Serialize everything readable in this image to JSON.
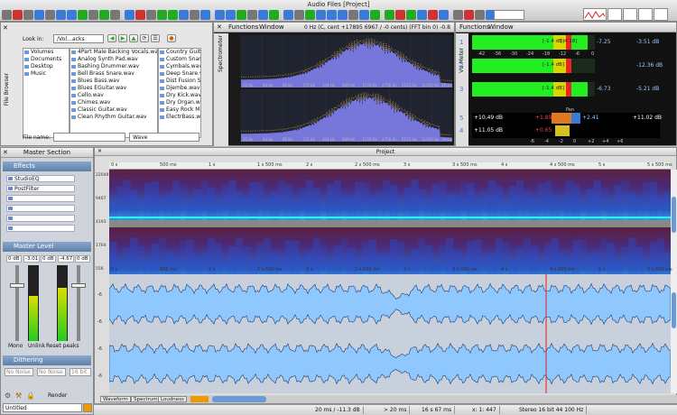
{
  "app": {
    "title": "Audio Files [Project]"
  },
  "colors": {
    "meter_green": "#22ee22",
    "meter_yellow": "#d8d800",
    "meter_red": "#ee2222",
    "spectrum_fill": "#8080ee",
    "waveform_fill": "#8ec8ff",
    "spectro_bg": "#3c1850",
    "accent_blue": "#3a7ad8",
    "playhead": "#dd2222"
  },
  "file_browser": {
    "label": "File Browser",
    "look_in_label": "Look in:",
    "look_in_value": "/Vol…acks",
    "file_name_label": "File name:",
    "file_type_value": "Wave",
    "columns": [
      [
        "Volumes",
        "Documents",
        "Desktop",
        "Music"
      ],
      [
        "4Part Male Backing Vocals.wav",
        "Analog Synth Pad.wav",
        "Bashing Drummer.wav",
        "Bell Brass Snare.wav",
        "Blues Bass.wav",
        "Blues EGuitar.wav",
        "Cello.wav",
        "Chimes.wav",
        "Classic Guitar.wav",
        "Clean Rhythm Guitar.wav"
      ],
      [
        "Country Guita",
        "Custom Snare",
        "Cymbals.wav",
        "Deep Snare.w",
        "Dist Fusion S",
        "Djembe.wav",
        "Dry Kick.wav",
        "Dry Organ.wa",
        "Easy Rock M",
        "ElectrBass.w"
      ]
    ]
  },
  "spectrometer": {
    "label": "Spectrometer",
    "menu": [
      "Functions",
      "Window"
    ],
    "readout": "0 Hz (C, cent +17895 6967 / -0 cents) (FFT bin 0) -0.8 dB",
    "freq_ticks": [
      "22 Hz",
      "44 Hz",
      "86 Hz",
      "172 Hz",
      "344 Hz",
      "689 Hz",
      "1378 Hz",
      "2756 Hz",
      "5513 Hz",
      "11025 Hz",
      "19,63"
    ]
  },
  "vu_meter": {
    "label": "VU Meter",
    "menu": [
      "Functions",
      "Window"
    ],
    "rows": [
      {
        "num": "1",
        "left": "-7.25",
        "right": "-3.51 dB",
        "mid": "[-1.4 dB]",
        "mid2": "[-4.18]"
      },
      {
        "num": "2",
        "left": "",
        "right": "-12.36 dB",
        "mid": "[-1.4 dB]",
        "mid2": ""
      },
      {
        "num": "3",
        "left": "-6.73",
        "right": "-5.21 dB",
        "mid": "[-1.4 dB]",
        "mid2": ""
      }
    ],
    "scale": [
      "-42",
      "-36",
      "-30",
      "-24",
      "-18",
      "-12",
      "-6",
      "0"
    ],
    "pan_label": "Pan",
    "corr_rows": [
      {
        "num": "5",
        "l": "+10.49 dB",
        "m": "+1.89",
        "r": "+2.41",
        "rr": "+11.02 dB"
      },
      {
        "num": "4",
        "l": "+11.05 dB",
        "m": "+0.65",
        "r": "",
        "rr": ""
      }
    ],
    "bottom_scale": [
      "-6",
      "-4",
      "-2",
      "0",
      "+2",
      "+4",
      "+6"
    ]
  },
  "master": {
    "title": "Master Section",
    "effects_label": "Effects",
    "effects": [
      "StudioEQ",
      "PostFilter",
      "",
      "",
      "",
      ""
    ],
    "level_label": "Master Level",
    "level_values": [
      "0 dB",
      "-3.01",
      "0 dB",
      "-4.67",
      "0 dB"
    ],
    "buttons": [
      "Mono",
      "Unlink",
      "Reset peaks"
    ],
    "dithering_label": "Dithering",
    "dither_values": [
      "No Noise",
      "No Noise",
      "16 bit"
    ],
    "render_label": "Render",
    "preset_value": "Untitled"
  },
  "project": {
    "title": "Project",
    "time_ticks": [
      "0 s",
      "500 ms",
      "1 s",
      "1 s 500 ms",
      "2 s",
      "2 s 500 ms",
      "3 s",
      "3 s 500 ms",
      "4 s",
      "4 s 500 ms",
      "5 s",
      "5 s 500 ms"
    ],
    "spectro_freq": [
      "22049",
      "9467",
      "4193",
      "1764",
      "556"
    ],
    "tabs": [
      "Waveform",
      "Spectrum",
      "Loudness"
    ],
    "wave_db": [
      "-6",
      "-6",
      "-6",
      "-6"
    ]
  },
  "status": {
    "segments": [
      "20 ms / -11.3 dB",
      "> 20 ms",
      "16 s 67 ms",
      "x: 1: 447",
      "Stereo 16 bit 44 100 Hz"
    ]
  }
}
